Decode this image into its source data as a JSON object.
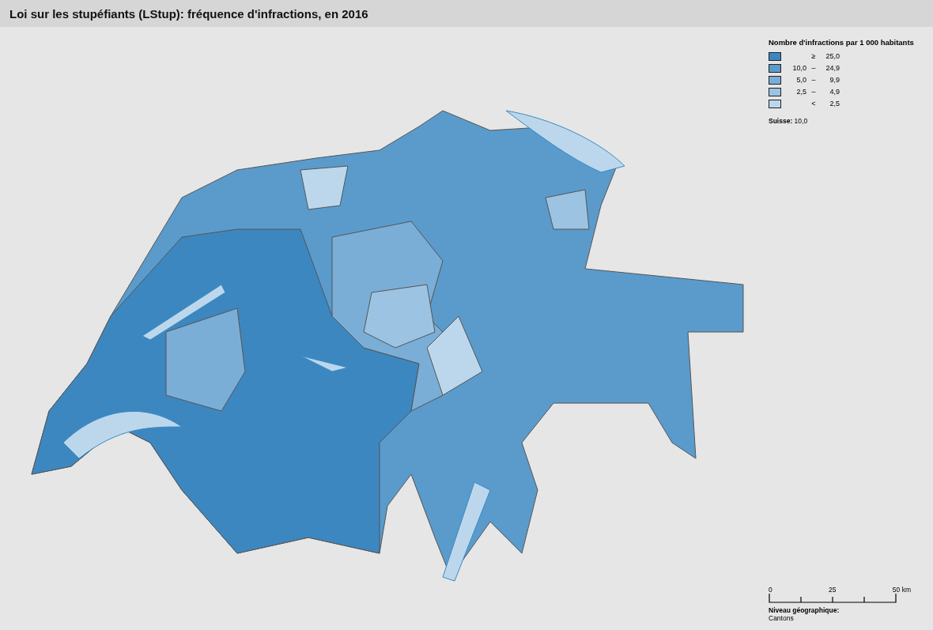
{
  "title": "Loi sur les stupéfiants (LStup): fréquence d'infractions, en 2016",
  "legend": {
    "title": "Nombre d'infractions par 1 000 habitants",
    "classes": [
      {
        "symbol": "≥",
        "high": "25,0",
        "color": "#3d87c0"
      },
      {
        "low": "10,0",
        "symbol": "–",
        "high": "24,9",
        "color": "#5a9bcc"
      },
      {
        "low": "5,0",
        "symbol": "–",
        "high": "9,9",
        "color": "#7aaed7"
      },
      {
        "low": "2,5",
        "symbol": "–",
        "high": "4,9",
        "color": "#9dc3e2"
      },
      {
        "symbol": "<",
        "high": "2,5",
        "color": "#bcd7ec"
      }
    ],
    "national": "**Suisse:** 10,0"
  },
  "scale": {
    "ticks": [
      "0",
      "25",
      "50 km"
    ]
  },
  "level": {
    "label": "Niveau géographique:",
    "value": "Cantons"
  }
}
